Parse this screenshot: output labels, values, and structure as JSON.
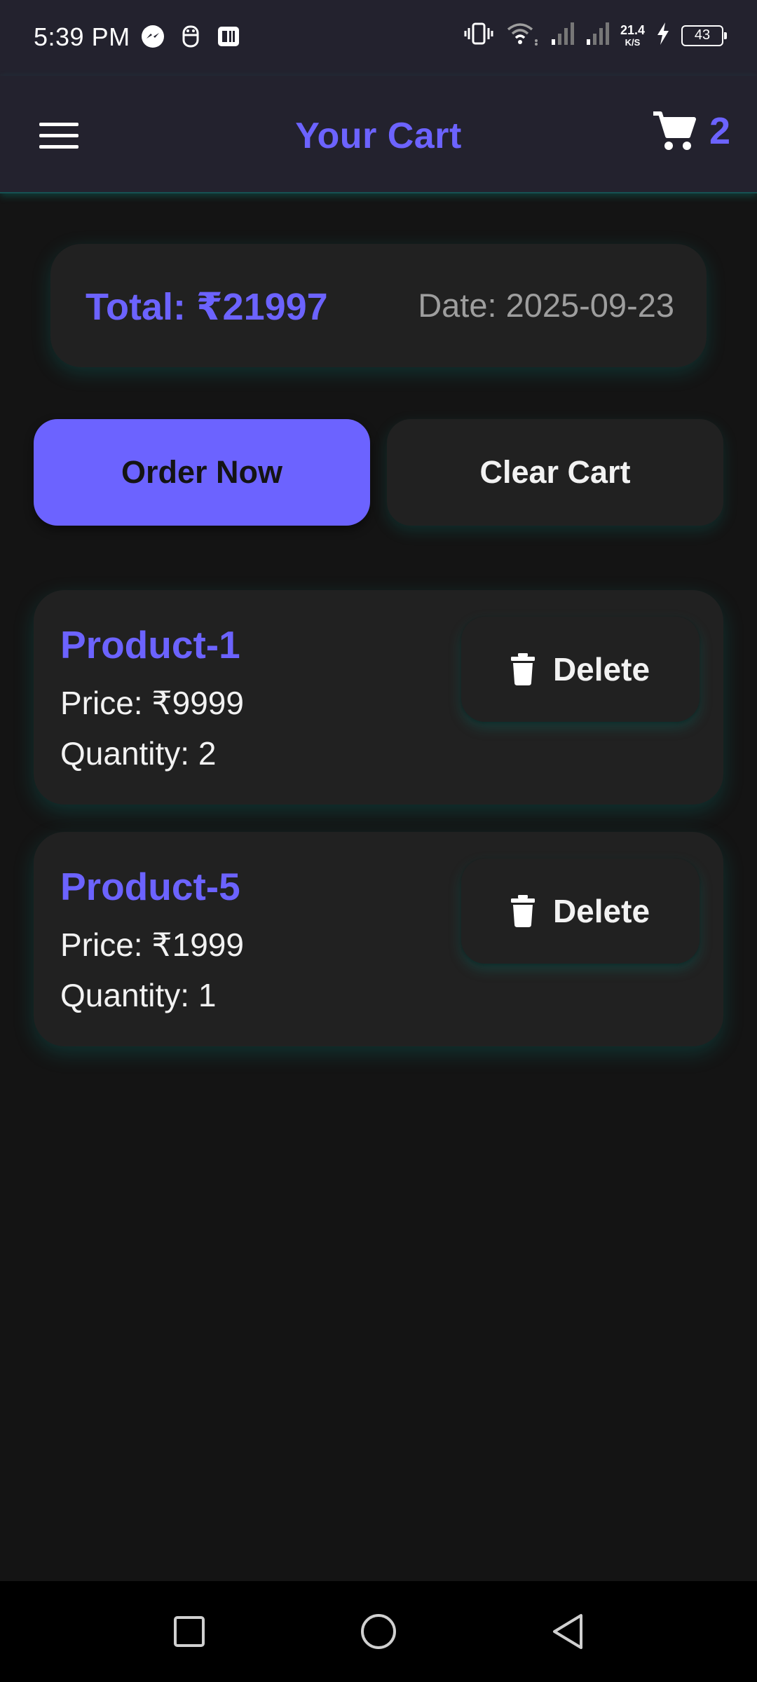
{
  "status_bar": {
    "time": "5:39 PM",
    "speed_value": "21.4",
    "speed_unit": "K/S",
    "battery": "43",
    "icons": [
      "messenger-icon",
      "bot-icon",
      "paytm-icon",
      "vibrate-icon",
      "wifi-icon",
      "signal-icon",
      "signal-icon",
      "charging-icon",
      "battery-icon"
    ]
  },
  "app_bar": {
    "title": "Your Cart",
    "cart_count": "2"
  },
  "summary": {
    "total": "Total: ₹21997",
    "date": "Date: 2025-09-23"
  },
  "actions": {
    "order_label": "Order Now",
    "clear_label": "Clear Cart"
  },
  "items": [
    {
      "name": "Product-1",
      "price": "Price: ₹9999",
      "quantity": "Quantity: 2",
      "delete_label": "Delete"
    },
    {
      "name": "Product-5",
      "price": "Price: ₹1999",
      "quantity": "Quantity: 1",
      "delete_label": "Delete"
    }
  ],
  "colors": {
    "accent": "#6c63ff",
    "background": "#141414",
    "card": "#212121",
    "app_bar": "#23222e",
    "glow": "#00a096"
  }
}
